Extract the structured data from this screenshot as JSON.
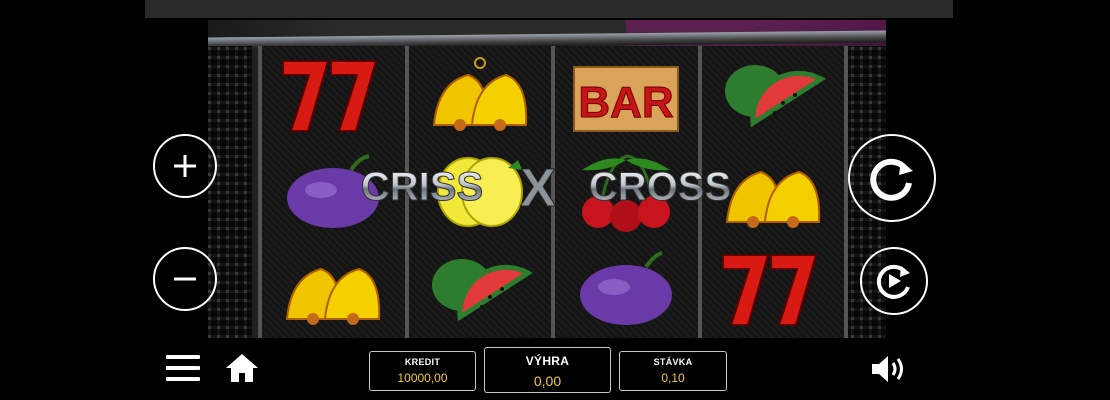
{
  "game": {
    "logo_text_left": "CRISS",
    "logo_text_x": "X",
    "logo_text_right": "CROSS"
  },
  "reels": [
    [
      "seven-symbol",
      "plum-symbol",
      "bell-symbol"
    ],
    [
      "bell-symbol",
      "lemon-symbol",
      "watermelon-symbol"
    ],
    [
      "bar-symbol",
      "cherry-symbol",
      "plum-symbol"
    ],
    [
      "watermelon-symbol",
      "bell-symbol",
      "seven-symbol"
    ]
  ],
  "bar_label": "BAR",
  "credit": {
    "label": "KREDIT",
    "value": "10000,00"
  },
  "win": {
    "label": "VÝHRA",
    "value": "0,00"
  },
  "bet": {
    "label": "STÁVKA",
    "value": "0,10"
  },
  "colors": {
    "value_text": "#f5c83a",
    "seven": "#d81a12",
    "bell": "#f1c400",
    "plum": "#6a3aa8"
  },
  "icons": [
    "plus-icon",
    "minus-icon",
    "spin-icon",
    "autoplay-icon",
    "menu-icon",
    "home-icon",
    "sound-icon"
  ]
}
